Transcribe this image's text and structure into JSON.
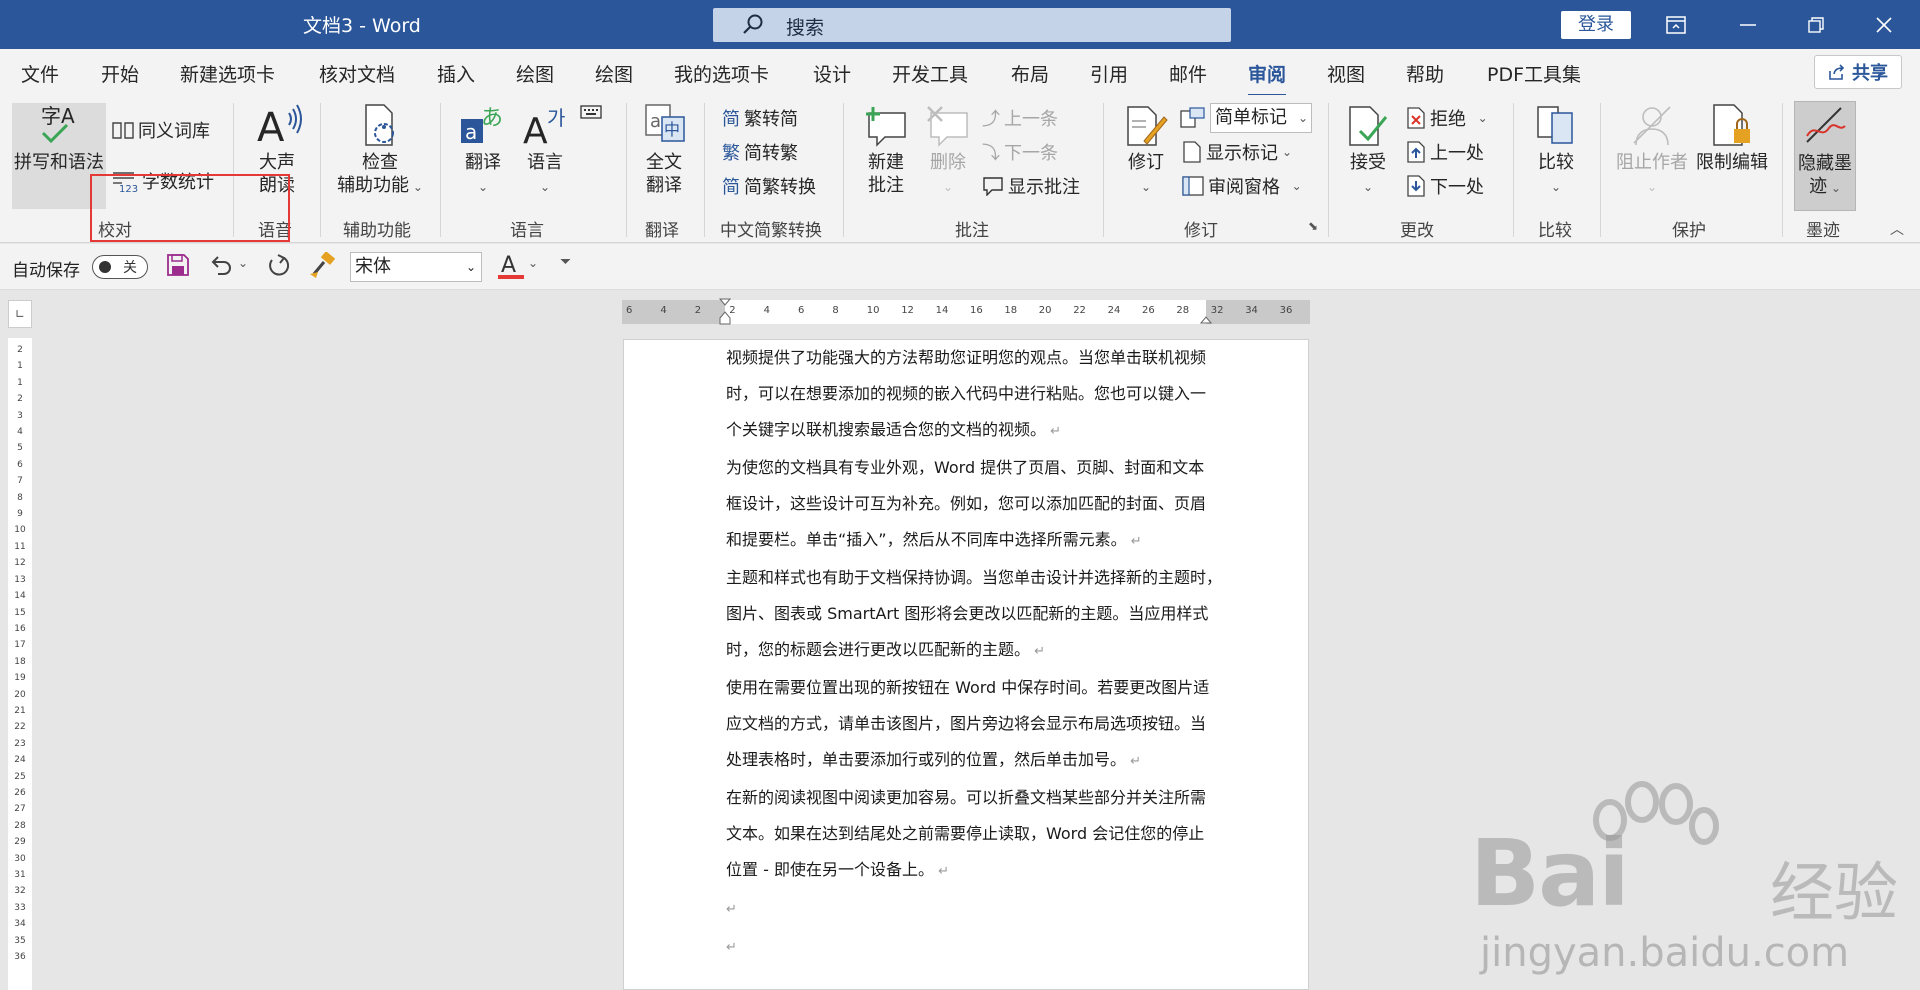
{
  "titlebar": {
    "title": "文档3  -  Word",
    "search_placeholder": "搜索",
    "login": "登录"
  },
  "tabs": [
    "文件",
    "开始",
    "新建选项卡",
    "核对文档",
    "插入",
    "绘图",
    "绘图",
    "我的选项卡",
    "设计",
    "开发工具",
    "布局",
    "引用",
    "邮件",
    "审阅",
    "视图",
    "帮助",
    "PDF工具集"
  ],
  "active_tab": "审阅",
  "share": "共享",
  "ribbon": {
    "proofing": {
      "spelling": "拼写和语法",
      "spelling_icon_text": "字A",
      "thesaurus": "同义词库",
      "word_count": "字数统计",
      "label": "校对"
    },
    "speech": {
      "read_aloud_1": "大声",
      "read_aloud_2": "朗读",
      "label": "语音"
    },
    "accessibility": {
      "check_1": "检查",
      "check_2": "辅助功能",
      "label": "辅助功能"
    },
    "language": {
      "translate": "翻译",
      "language": "语言",
      "label": "语言"
    },
    "translation": {
      "full_1": "全文",
      "full_2": "翻译",
      "label": "翻译"
    },
    "chinese": {
      "t2s": "繁转简",
      "s2t": "简转繁",
      "convert": "简繁转换",
      "label": "中文简繁转换"
    },
    "comments": {
      "new_1": "新建",
      "new_2": "批注",
      "delete": "删除",
      "prev": "上一条",
      "next": "下一条",
      "show": "显示批注",
      "label": "批注"
    },
    "tracking": {
      "track": "修订",
      "markup_select": "简单标记",
      "show_markup": "显示标记",
      "review_pane": "审阅窗格",
      "label": "修订"
    },
    "changes": {
      "accept": "接受",
      "reject": "拒绝",
      "prev": "上一处",
      "next": "下一处",
      "label": "更改"
    },
    "compare": {
      "compare": "比较",
      "label": "比较"
    },
    "protect": {
      "block": "阻止作者",
      "restrict": "限制编辑",
      "label": "保护"
    },
    "ink": {
      "hide_1": "隐藏墨",
      "hide_2": "迹",
      "label": "墨迹"
    }
  },
  "qat": {
    "autosave": "自动保存",
    "toggle": "关",
    "font": "宋体"
  },
  "ruler": {
    "h_ticks": [
      "6",
      "4",
      "2",
      "2",
      "4",
      "6",
      "8",
      "10",
      "12",
      "14",
      "16",
      "18",
      "20",
      "22",
      "24",
      "26",
      "28",
      "32",
      "34",
      "36"
    ],
    "v_ticks": [
      "2",
      "1",
      "1",
      "2",
      "3",
      "4",
      "5",
      "6",
      "7",
      "8",
      "9",
      "10",
      "11",
      "12",
      "13",
      "14",
      "15",
      "16",
      "17",
      "18",
      "19",
      "20",
      "21",
      "22",
      "23",
      "24",
      "25",
      "26",
      "27",
      "28",
      "29",
      "30",
      "31",
      "32",
      "33",
      "34",
      "35",
      "36"
    ]
  },
  "document": {
    "lines": [
      "视频提供了功能强大的方法帮助您证明您的观点。当您单击联机视频",
      "时，可以在想要添加的视频的嵌入代码中进行粘贴。您也可以键入一",
      "个关键字以联机搜索最适合您的文档的视频。",
      "为使您的文档具有专业外观，Word 提供了页眉、页脚、封面和文本",
      "框设计，这些设计可互为补充。例如，您可以添加匹配的封面、页眉",
      "和提要栏。单击“插入”，然后从不同库中选择所需元素。",
      "主题和样式也有助于文档保持协调。当您单击设计并选择新的主题时，",
      "图片、图表或 SmartArt 图形将会更改以匹配新的主题。当应用样式",
      "时，您的标题会进行更改以匹配新的主题。",
      "使用在需要位置出现的新按钮在 Word 中保存时间。若要更改图片适",
      "应文档的方式，请单击该图片，图片旁边将会显示布局选项按钮。当",
      "处理表格时，单击要添加行或列的位置，然后单击加号。",
      "在新的阅读视图中阅读更加容易。可以折叠文档某些部分并关注所需",
      "文本。如果在达到结尾处之前需要停止读取，Word 会记住您的停止",
      "位置 - 即使在另一个设备上。",
      "",
      ""
    ],
    "para_mark": "↵"
  },
  "watermark": {
    "brand": "Bai",
    "brand2": "经验",
    "url": "jingyan.baidu.com"
  },
  "colors": {
    "titlebar": "#2b579a",
    "highlight": "#e53935",
    "font_color_bar": "#e53935"
  }
}
